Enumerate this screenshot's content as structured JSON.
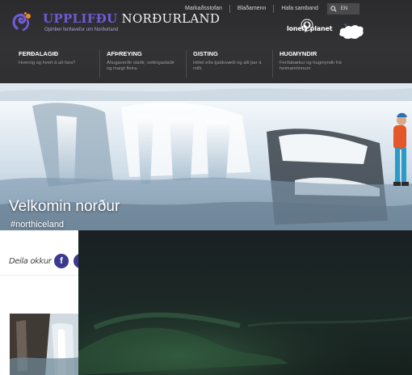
{
  "topbar": {
    "links": [
      "Markaðsstofan",
      "Blaðamenn",
      "Hafa samband"
    ],
    "lang": "EN"
  },
  "brand": {
    "name_part1": "UPPLIFÐU",
    "name_part2": "NORÐURLAND",
    "tagline": "Opinber ferðavefur um Norðurland"
  },
  "partners": {
    "lonely_planet": "lonely planet"
  },
  "nav": [
    {
      "title": "FERÐALAGIÐ",
      "desc": "Hvernig og hvert á að fara?"
    },
    {
      "title": "AFÞREYING",
      "desc": "Áhugaverðir staðir, veitingastaðir og margt fleira."
    },
    {
      "title": "GISTING",
      "desc": "Hótel eða tjaldsvæði og allt þar á milli."
    },
    {
      "title": "HUGMYNDIR",
      "desc": "Ferðabækur og hugmyndir frá heimamönnum"
    }
  ],
  "hero": {
    "title": "Velkomin norður",
    "hashtag": "#northiceland"
  },
  "share": {
    "label": "Deila okkur",
    "facebook_letter": "f"
  },
  "colors": {
    "brand_purple": "#6f5bd6",
    "header_bg": "#2f2f31",
    "social_blue": "#3b3a8f"
  },
  "icons": {
    "search": "search-icon",
    "logo": "spiral-logo-icon",
    "iceland": "iceland-map-icon"
  }
}
